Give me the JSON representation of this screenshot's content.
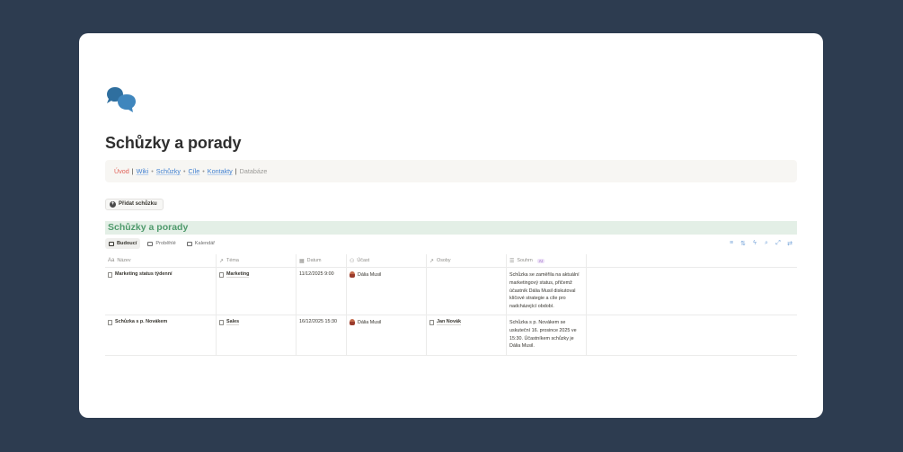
{
  "page": {
    "title": "Schůzky a porady",
    "icon": "speech-bubbles-icon"
  },
  "nav": {
    "items": [
      {
        "label": "Úvod",
        "style": "red"
      },
      {
        "label": "Wiki",
        "style": "blue"
      },
      {
        "label": "Schůzky",
        "style": "blue"
      },
      {
        "label": "Cíle",
        "style": "blue"
      },
      {
        "label": "Kontakty",
        "style": "blue"
      },
      {
        "label": "Databáze",
        "style": "muted"
      }
    ]
  },
  "add_button": {
    "label": "Přidat schůzku"
  },
  "database": {
    "title": "Schůzky a porady",
    "views": [
      {
        "label": "Budoucí",
        "active": true
      },
      {
        "label": "Proběhlé",
        "active": false
      },
      {
        "label": "Kalendář",
        "active": false
      }
    ],
    "columns": [
      {
        "label": "Název",
        "icon": "text-icon"
      },
      {
        "label": "Téma",
        "icon": "relation-arrow-icon"
      },
      {
        "label": "Datum",
        "icon": "calendar-icon"
      },
      {
        "label": "Účast",
        "icon": "people-icon"
      },
      {
        "label": "Osoby",
        "icon": "relation-arrow-icon"
      },
      {
        "label": "Souhrn",
        "icon": "list-icon",
        "badge": "AI"
      }
    ],
    "rows": [
      {
        "name": "Marketing status týdenní",
        "topic": "Marketing",
        "date": "11/12/2025 9:00",
        "attendee": "Dália Musil",
        "person": "",
        "summary": "Schůzka se zaměřila na aktuální marketingový status, přičemž účastník Dália Musil diskutoval klíčové strategie a cíle pro nadcházející období."
      },
      {
        "name": "Schůzka s p. Novákem",
        "topic": "Sales",
        "date": "16/12/2025 15:30",
        "attendee": "Dália Musil",
        "person": "Jan Novák",
        "summary": "Schůzka s p. Novákem se uskuteční 16. prosince 2025 ve 15:30. Účastníkem schůzky je Dália Musil."
      }
    ]
  },
  "colors": {
    "background": "#2d3c50",
    "card": "#ffffff",
    "db_title_bg": "#e3efe6",
    "db_title_text": "#4f9a6c",
    "link_blue": "#3f7fd0",
    "link_red": "#e16259",
    "icon_blue": "#3b7fb3"
  }
}
